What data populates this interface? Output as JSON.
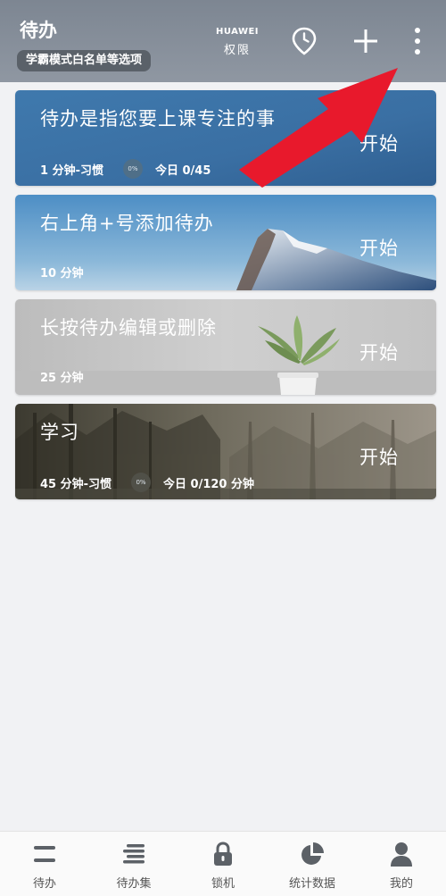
{
  "header": {
    "title": "待办",
    "mode_chip": "学霸模式白名单等选项",
    "permission_brand": "HUAWEI",
    "permission_label": "权限",
    "icons": [
      "location-clock-icon",
      "plus-icon",
      "more-vertical-icon"
    ]
  },
  "todos": [
    {
      "title": "待办是指您要上课专注的事",
      "duration": "1 分钟-习惯",
      "percent": "0%",
      "today": "今日 0/45",
      "start": "开始",
      "bg": "blue-sky"
    },
    {
      "title": "右上角+号添加待办",
      "duration": "10 分钟",
      "start": "开始",
      "bg": "snow-mountain"
    },
    {
      "title": "长按待办编辑或删除",
      "duration": "25 分钟",
      "start": "开始",
      "bg": "gray-plant"
    },
    {
      "title": "学习",
      "duration": "45 分钟-习惯",
      "percent": "0%",
      "today": "今日 0/120  分钟",
      "start": "开始",
      "bg": "forest"
    }
  ],
  "annotation": {
    "type": "red-arrow",
    "color": "#e8192c"
  },
  "bottom_nav": [
    {
      "label": "待办",
      "icon": "list-icon"
    },
    {
      "label": "待办集",
      "icon": "list-set-icon"
    },
    {
      "label": "锁机",
      "icon": "lock-icon"
    },
    {
      "label": "统计数据",
      "icon": "pie-chart-icon"
    },
    {
      "label": "我的",
      "icon": "person-icon"
    }
  ],
  "colors": {
    "header": "#8a929d",
    "nav_icon": "#5c6167",
    "arrow": "#e8192c"
  }
}
